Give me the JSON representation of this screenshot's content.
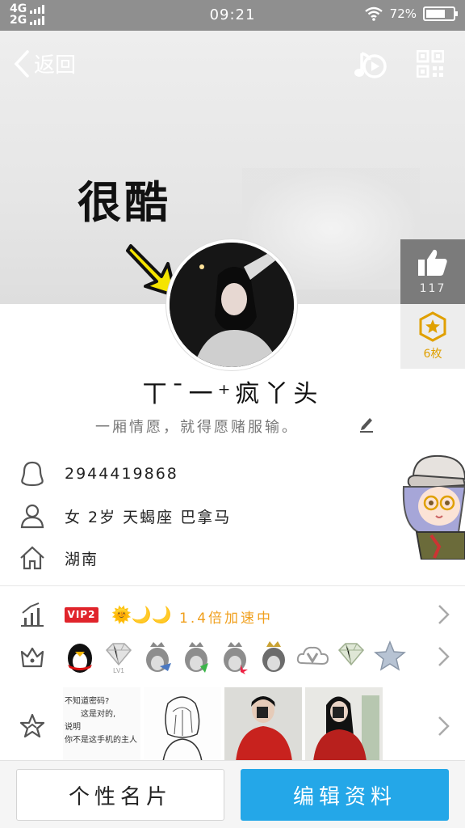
{
  "status_bar": {
    "network_top": "4G",
    "network_bottom": "2G",
    "time": "09:21",
    "battery_text": "72%",
    "battery_level": 0.72
  },
  "nav": {
    "back_label": "返回"
  },
  "cover": {
    "caption": "很酷"
  },
  "side_panel": {
    "like_count": "117",
    "medal_count": "6枚"
  },
  "profile": {
    "nickname": "丅ˉ一⁺疯丫头",
    "signature": "一厢情愿，就得愿赌服输。"
  },
  "info": {
    "qq_number": "2944419868",
    "basic": "女  2岁   天蝎座   巴拿马",
    "location": "湖南"
  },
  "vip": {
    "badge": "VIP2",
    "speed_icons": "🌞🌙🌙",
    "speed_text": "1.4倍加速中"
  },
  "photos": {
    "note_lines": [
      "不知道密码?",
      "这是对的,",
      "说明",
      "你不是这手机的主人"
    ]
  },
  "bottom": {
    "card_label": "个性名片",
    "edit_label": "编辑资料"
  },
  "colors": {
    "accent_blue": "#24a7e8",
    "vip_red": "#e0242b",
    "speed_orange": "#f0a01e",
    "medal_gold": "#e0a000"
  }
}
